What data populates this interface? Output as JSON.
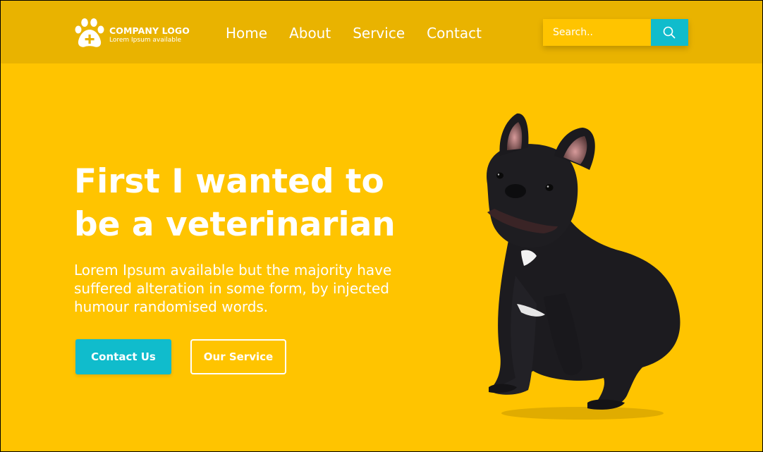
{
  "brand": {
    "title": "COMPANY LOGO",
    "subtitle": "Lorem Ipsum available",
    "icon": "paw-cross-icon"
  },
  "nav": {
    "items": [
      {
        "label": "Home"
      },
      {
        "label": "About"
      },
      {
        "label": "Service"
      },
      {
        "label": "Contact"
      }
    ]
  },
  "search": {
    "placeholder": "Search..",
    "value": "",
    "icon": "search-icon"
  },
  "hero": {
    "title": "First I wanted to be a veterinarian",
    "text": "Lorem Ipsum available but the majority have suffered alteration in some form, by injected humour randomised words.",
    "primary_button": "Contact Us",
    "secondary_button": "Our Service",
    "image": "french-bulldog-image"
  },
  "colors": {
    "background": "#ffc400",
    "header": "#e9b300",
    "accent": "#10bccc",
    "text": "#ffffff"
  }
}
